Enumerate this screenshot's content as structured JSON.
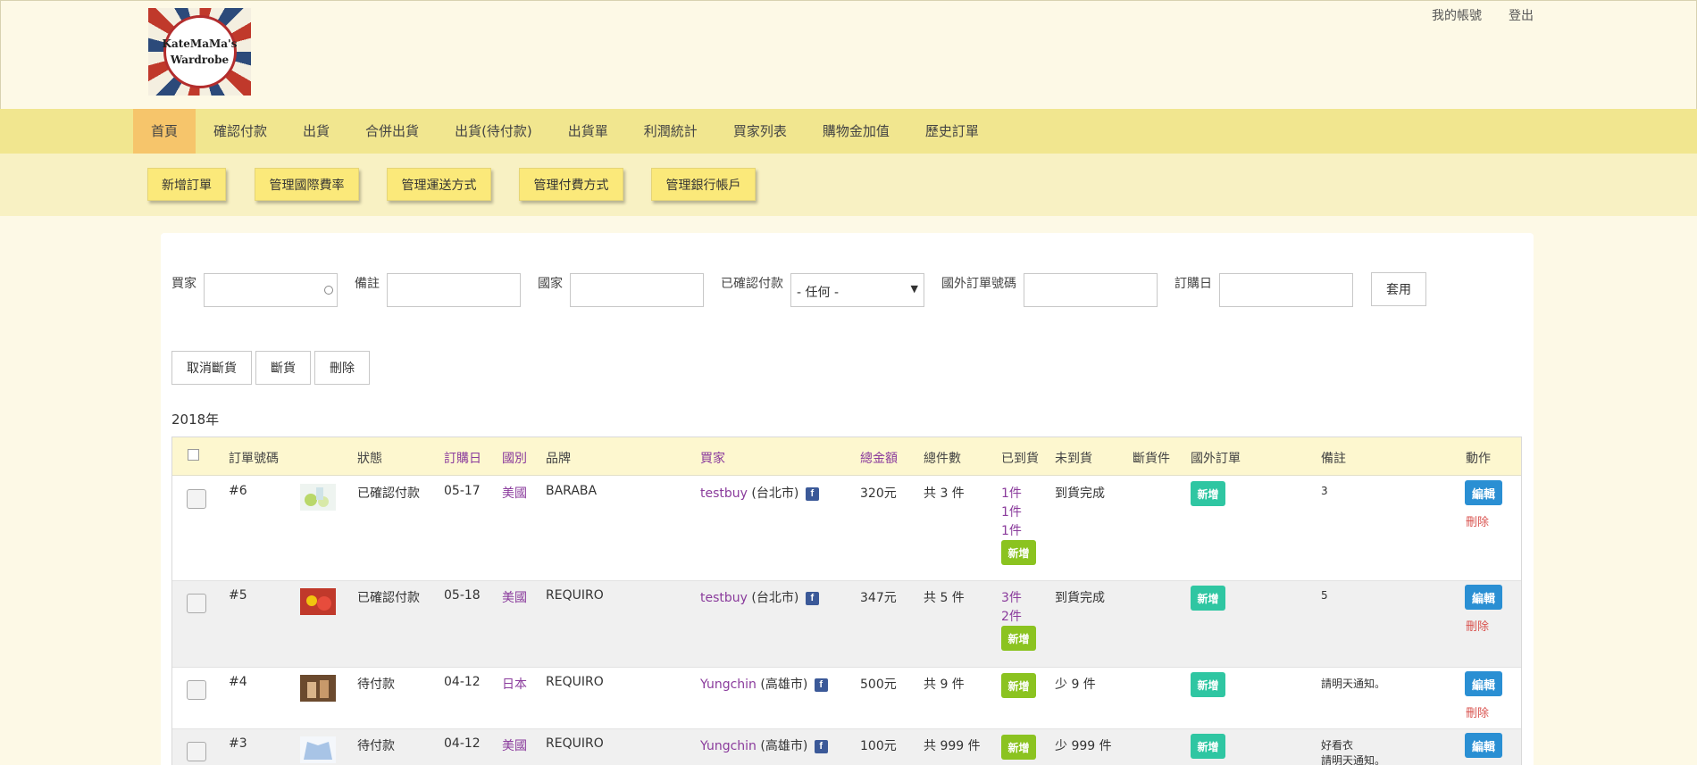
{
  "logo": {
    "line1": "KateMaMa's",
    "line2": "Wardrobe"
  },
  "user_links": {
    "account": "我的帳號",
    "logout": "登出"
  },
  "main_nav": [
    "首頁",
    "確認付款",
    "出貨",
    "合併出貨",
    "出貨(待付款)",
    "出貨單",
    "利潤統計",
    "買家列表",
    "購物金加值",
    "歷史訂單"
  ],
  "sub_nav": [
    "新增訂單",
    "管理國際費率",
    "管理運送方式",
    "管理付費方式",
    "管理銀行帳戶"
  ],
  "filters": {
    "buyer": "買家",
    "note": "備註",
    "country": "國家",
    "confirmed": "已確認付款",
    "confirmed_value": "- 任何 -",
    "foreign_order": "國外訂單號碼",
    "order_date": "訂購日",
    "apply": "套用"
  },
  "actions": {
    "cancel_out": "取消斷貨",
    "out": "斷貨",
    "delete": "刪除"
  },
  "year_label": "2018年",
  "columns": {
    "order_no": "訂單號碼",
    "status": "狀態",
    "order_date": "訂購日",
    "country": "國別",
    "brand": "品牌",
    "buyer": "買家",
    "total": "總金額",
    "total_items": "總件數",
    "arrived": "已到貨",
    "not_arrived": "未到貨",
    "out_of_stock": "斷貨件",
    "foreign_order": "國外訂單",
    "note": "備註",
    "action": "動作"
  },
  "btn": {
    "add": "新增",
    "edit": "編輯",
    "delete": "刪除"
  },
  "rows": [
    {
      "order_no": "#6",
      "status": "已確認付款",
      "date": "05-17",
      "country": "美國",
      "brand": "BARABA",
      "buyer_name": "testbuy",
      "buyer_city": "(台北市)",
      "total": "320元",
      "items": "共 3 件",
      "arrived": [
        "1件",
        "1件",
        "1件"
      ],
      "not_arrived": "到貨完成",
      "note_lines": [
        "3"
      ],
      "can_delete": true
    },
    {
      "order_no": "#5",
      "status": "已確認付款",
      "date": "05-18",
      "country": "美國",
      "brand": "REQUIRO",
      "buyer_name": "testbuy",
      "buyer_city": "(台北市)",
      "total": "347元",
      "items": "共 5 件",
      "arrived": [
        "3件",
        "2件"
      ],
      "not_arrived": "到貨完成",
      "note_lines": [
        "5"
      ],
      "can_delete": true
    },
    {
      "order_no": "#4",
      "status": "待付款",
      "date": "04-12",
      "country": "日本",
      "brand": "REQUIRO",
      "buyer_name": "Yungchin",
      "buyer_city": "(高雄市)",
      "total": "500元",
      "items": "共 9 件",
      "arrived": [],
      "not_arrived": "少 9 件",
      "note_lines": [
        "請明天通知。"
      ],
      "can_delete": true
    },
    {
      "order_no": "#3",
      "status": "待付款",
      "date": "04-12",
      "country": "美國",
      "brand": "REQUIRO",
      "buyer_name": "Yungchin",
      "buyer_city": "(高雄市)",
      "total": "100元",
      "items": "共 999 件",
      "arrived": [],
      "not_arrived": "少 999 件",
      "note_lines": [
        "好看衣",
        "請明天通知。"
      ],
      "can_delete": false
    }
  ]
}
